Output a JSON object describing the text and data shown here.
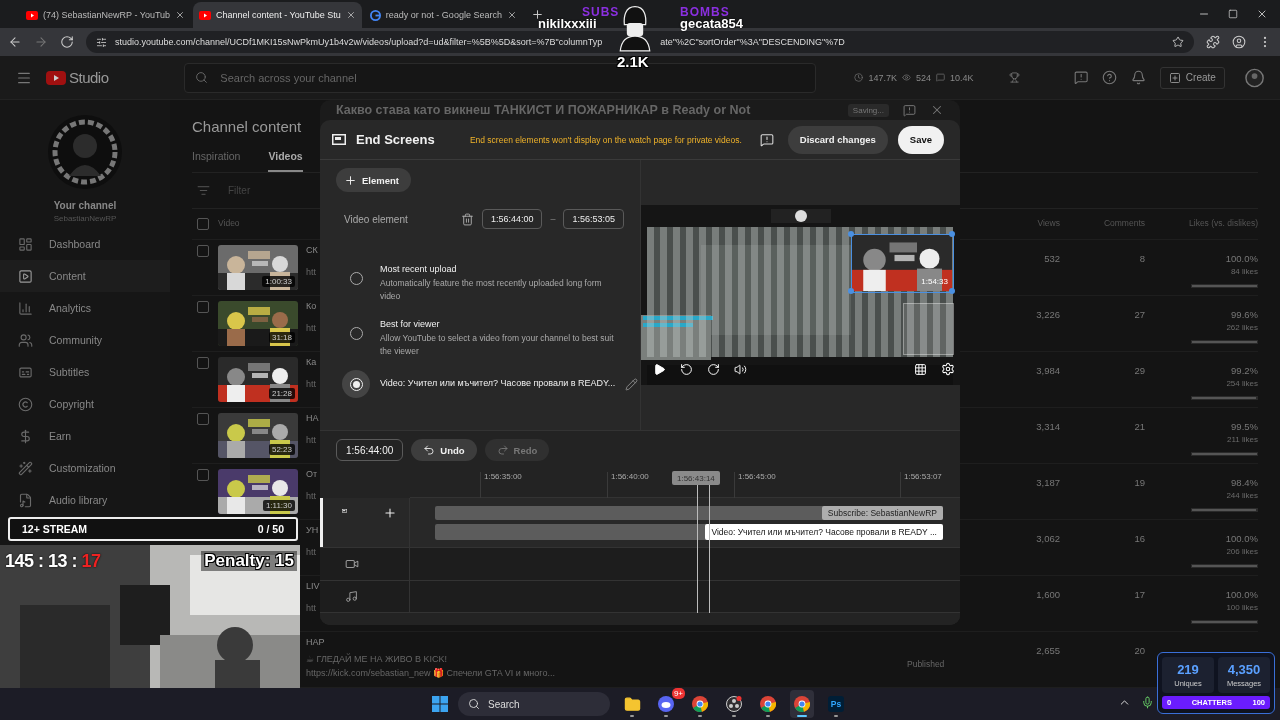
{
  "browser": {
    "tabs": [
      {
        "title": "(74) SebastianNewRP - YouTub",
        "kind": "youtube",
        "selected": false
      },
      {
        "title": "Channel content - YouTube Stu",
        "kind": "youtube",
        "selected": true
      },
      {
        "title": "ready or not - Google Search",
        "kind": "google",
        "selected": false
      }
    ],
    "url_start": "studio.youtube.com/channel/UCDf1MKI15sNwPkmUy1b4v2w/videos/upload?d=ud&filter=%5B%5D&sort=%7B\"columnTyp",
    "url_end": "ate\"%2C\"sortOrder\"%3A\"DESCENDING\"%7D"
  },
  "studio": {
    "logo": "Studio",
    "search_placeholder": "Search across your channel",
    "stats": [
      "147.7K",
      "524",
      "10.4K"
    ],
    "create": "Create"
  },
  "sidebar": {
    "channel_label": "Your channel",
    "channel_name": "SebastianNewRP",
    "items": [
      {
        "label": "Dashboard",
        "kind": "dashboard",
        "selected": false
      },
      {
        "label": "Content",
        "kind": "content",
        "selected": true
      },
      {
        "label": "Analytics",
        "kind": "analytics",
        "selected": false
      },
      {
        "label": "Community",
        "kind": "community",
        "selected": false
      },
      {
        "label": "Subtitles",
        "kind": "subtitles",
        "selected": false
      },
      {
        "label": "Copyright",
        "kind": "copyright",
        "selected": false
      },
      {
        "label": "Earn",
        "kind": "earn",
        "selected": false
      },
      {
        "label": "Customization",
        "kind": "customization",
        "selected": false
      },
      {
        "label": "Audio library",
        "kind": "audio",
        "selected": false
      }
    ]
  },
  "content": {
    "title": "Channel content",
    "tabs": [
      {
        "label": "Inspiration",
        "selected": false
      },
      {
        "label": "Videos",
        "selected": true
      }
    ],
    "filter_placeholder": "Filter",
    "select_all_checked": false,
    "columns": [
      "Video",
      "Views",
      "Comments",
      "Likes (vs. dislikes)"
    ],
    "rows": [
      {
        "kind": "video",
        "checked": false,
        "title": "СК",
        "desc": "htt",
        "duration": "1:00:33",
        "views": "532",
        "comments": "8",
        "likes": "100.0%",
        "likes_count": "84 likes",
        "level": 1
      },
      {
        "kind": "video",
        "checked": false,
        "title": "Ко",
        "desc": "htt",
        "duration": "31:18",
        "views": "3,226",
        "comments": "27",
        "likes": "99.6%",
        "likes_count": "262 likes",
        "level": 0.996
      },
      {
        "kind": "video",
        "checked": false,
        "title": "Ка",
        "desc": "htt",
        "duration": "21:28",
        "views": "3,984",
        "comments": "29",
        "likes": "99.2%",
        "likes_count": "254 likes",
        "level": 0.992
      },
      {
        "kind": "video",
        "checked": false,
        "title": "НА",
        "desc": "htt",
        "duration": "52:23",
        "views": "3,314",
        "comments": "21",
        "likes": "99.5%",
        "likes_count": "211 likes",
        "level": 0.995
      },
      {
        "kind": "video",
        "checked": false,
        "title": "От",
        "desc": "htt",
        "duration": "1:11:30",
        "views": "3,187",
        "comments": "19",
        "likes": "98.4%",
        "likes_count": "244 likes",
        "level": 0.984
      },
      {
        "kind": "covered",
        "title": "УН",
        "desc": "htt",
        "views": "3,062",
        "comments": "16",
        "likes": "100.0%",
        "likes_count": "206 likes",
        "level": 1
      },
      {
        "kind": "covered",
        "title": "LIV",
        "desc": "htt",
        "views": "1,600",
        "comments": "17",
        "likes": "100.0%",
        "likes_count": "100 likes",
        "level": 1
      },
      {
        "kind": "covered",
        "title": "НАР",
        "desc": "☕ ГЛЕДАЙ МЕ НА ЖИВО В KICK!",
        "desc2": "https://kick.com/sebastian_new 🎁 Спечели GTA VI и много...",
        "status": "Published",
        "views": "2,655",
        "comments": "20"
      }
    ]
  },
  "editor": {
    "video_title": "Какво става като викнеш ТАНКИСТ И ПОЖАРНИКАР в Ready or Not",
    "saving": "Saving...",
    "panel_title": "End Screens",
    "warning": "End screen elements won't display on the watch page for private videos.",
    "discard": "Discard changes",
    "save": "Save",
    "add_element": "Element",
    "element_label": "Video element",
    "start": "1:56:44:00",
    "separator": "–",
    "end": "1:56:53:05",
    "options": [
      {
        "title": "Most recent upload",
        "description": "Automatically feature the most recently uploaded long form video",
        "selected": false
      },
      {
        "title": "Best for viewer",
        "description": "Allow YouTube to select a video from your channel to best suit the viewer",
        "selected": false
      },
      {
        "title": "Video: Учител или мъчител? Часове провали в READY...",
        "selected": true
      }
    ],
    "preview_duration": "1:54:33",
    "timecode": "1:56:44:00",
    "undo": {
      "label": "Undo",
      "disabled": false
    },
    "redo": {
      "label": "Redo",
      "disabled": true
    },
    "ruler": [
      "1:56:35:00",
      "1:56:40:00",
      "1:56:45:00",
      "1:56:53:07"
    ],
    "playhead": "1:56:43:14",
    "clips": [
      {
        "kind": "subscribe",
        "label": "Subscribe: SebastianNewRP"
      },
      {
        "kind": "video",
        "label": "Video: Учител или мъчител? Часове провали в READY ..."
      }
    ]
  },
  "stream_overlay": {
    "subs_label": "SUBS",
    "subs_name": "nikilxxxiii",
    "bombs_label": "BOMBS",
    "bombs_name": "gecata854",
    "count": "2.1K",
    "goal_title": "12+ STREAM",
    "goal_count": "0 / 50",
    "timer": "145 : 13 : ",
    "timer_alert": "17",
    "penalty": "Penalty: 15"
  },
  "chat_stats": {
    "uniques": "219",
    "uniques_label": "Uniques",
    "messages": "4,350",
    "messages_label": "Messages",
    "bar_min": "0",
    "bar_label": "CHATTERS",
    "bar_max": "100"
  },
  "taskbar": {
    "search": "Search",
    "apps": [
      {
        "kind": "folder",
        "selected": false
      },
      {
        "kind": "discord",
        "badge": "9+",
        "selected": false
      },
      {
        "kind": "chrome",
        "selected": false
      },
      {
        "kind": "obs",
        "selected": false
      },
      {
        "kind": "chrome",
        "selected": false
      },
      {
        "kind": "chrome",
        "selected": true
      },
      {
        "kind": "ps",
        "label": "Ps",
        "selected": false
      }
    ]
  }
}
